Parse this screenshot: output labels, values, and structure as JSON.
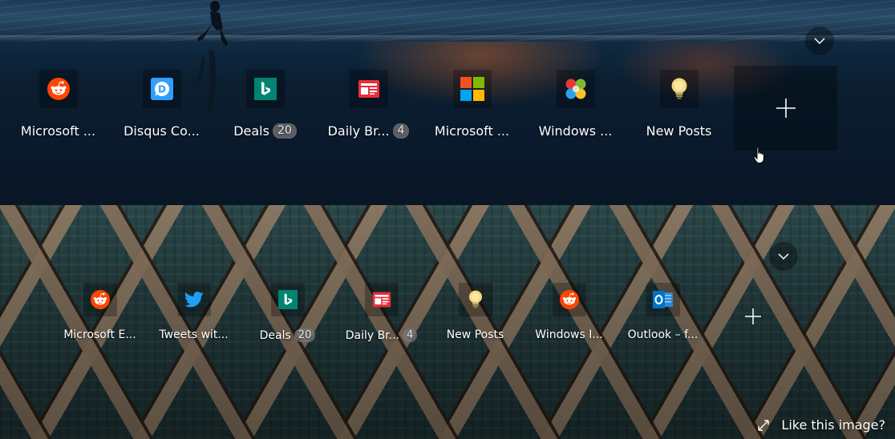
{
  "top_panel": {
    "tiles": [
      {
        "label": "Microsoft ...",
        "icon": "reddit-icon",
        "badge": ""
      },
      {
        "label": "Disqus Co...",
        "icon": "disqus-icon",
        "badge": ""
      },
      {
        "label": "Deals",
        "icon": "bing-icon",
        "badge": "20"
      },
      {
        "label": "Daily Br...",
        "icon": "news-icon",
        "badge": "4"
      },
      {
        "label": "Microsoft ...",
        "icon": "microsoft-logo-icon",
        "badge": ""
      },
      {
        "label": "Windows ...",
        "icon": "windows-insider-icon",
        "badge": ""
      },
      {
        "label": "New Posts",
        "icon": "lightbulb-icon",
        "badge": ""
      }
    ],
    "add_icon": "plus-icon",
    "chevron_icon": "chevron-down-icon"
  },
  "bottom_panel": {
    "tiles": [
      {
        "label": "Microsoft E...",
        "icon": "reddit-icon",
        "badge": ""
      },
      {
        "label": "Tweets wit...",
        "icon": "twitter-icon",
        "badge": ""
      },
      {
        "label": "Deals",
        "icon": "bing-icon",
        "badge": "20"
      },
      {
        "label": "Daily Br...",
        "icon": "news-icon",
        "badge": "4"
      },
      {
        "label": "New Posts",
        "icon": "lightbulb-icon",
        "badge": ""
      },
      {
        "label": "Windows I...",
        "icon": "reddit-icon",
        "badge": ""
      },
      {
        "label": "Outlook – f...",
        "icon": "outlook-icon",
        "badge": ""
      }
    ],
    "add_icon": "plus-icon",
    "chevron_icon": "chevron-down-icon",
    "like_image_label": "Like this image?",
    "like_image_icon": "expand-icon"
  },
  "colors": {
    "reddit": "#ff4500",
    "bing": "#008373",
    "disqus": "#2e9fff",
    "twitter": "#1da1f2",
    "news": "#e8303a",
    "outlook": "#0072c6",
    "lightbulb": "#f5d77a"
  }
}
